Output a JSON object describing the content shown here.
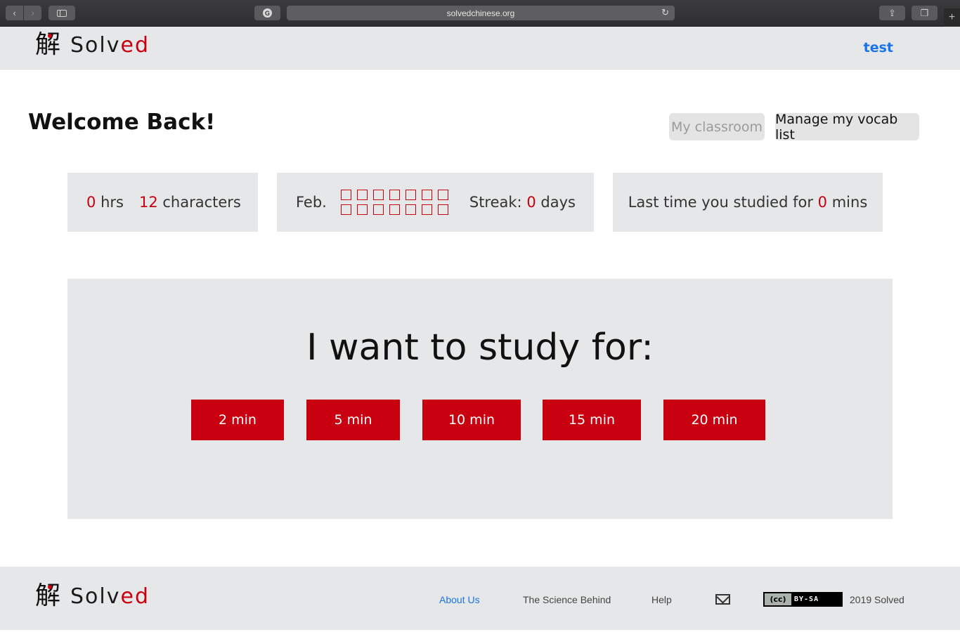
{
  "browser": {
    "url": "solvedchinese.org",
    "back_icon": "chevron-left-icon",
    "forward_icon": "chevron-right-icon"
  },
  "header": {
    "logo_glyph": "解",
    "logo_word_start": "Solv",
    "logo_word_end": "ed",
    "user": "test"
  },
  "main": {
    "welcome": "Welcome Back!",
    "classroom_label": "My classroom",
    "vocab_label": "Manage my vocab list",
    "stats": {
      "hours_value": "0",
      "hours_unit": "hrs",
      "characters_value": "12",
      "characters_unit": "characters",
      "month": "Feb.",
      "streak_label": "Streak:",
      "streak_value": "0",
      "streak_unit": "days",
      "last_label": "Last time you studied for",
      "last_value": "0",
      "last_unit": "mins"
    },
    "study_title": "I want to study for:",
    "durations": [
      "2 min",
      "5 min",
      "10 min",
      "15 min",
      "20 min"
    ]
  },
  "footer": {
    "links": [
      "About Us",
      "The Science Behind",
      "Help"
    ],
    "license_left": "(cc)",
    "license_right": "BY-SA",
    "copyright": "2019 Solved"
  },
  "colors": {
    "brand_red": "#c8000f",
    "link_blue": "#1a73e8",
    "panel_gray": "#e6e7e8"
  }
}
